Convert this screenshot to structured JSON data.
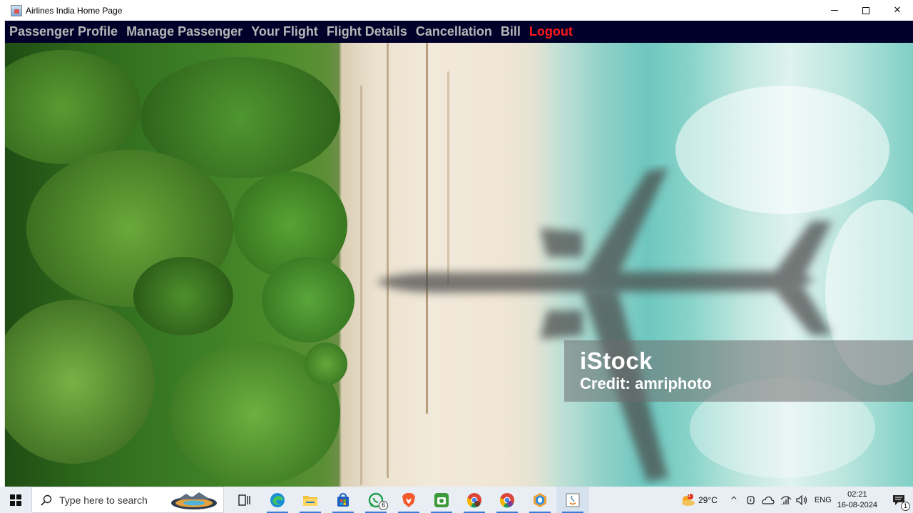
{
  "window": {
    "title": "Airlines India Home Page"
  },
  "menu": {
    "items": [
      {
        "label": "Passenger Profile"
      },
      {
        "label": "Manage Passenger"
      },
      {
        "label": "Your Flight"
      },
      {
        "label": "Flight Details"
      },
      {
        "label": "Cancellation"
      },
      {
        "label": "Bill"
      }
    ],
    "logout_label": "Logout",
    "colors": {
      "background": "#00002a",
      "item": "#b7b7b7",
      "logout": "#ff1a1a"
    }
  },
  "hero": {
    "watermark_brand": "iStock",
    "watermark_credit": "Credit: amriphoto"
  },
  "taskbar": {
    "search_placeholder": "Type here to search",
    "whatsapp_badge": "6",
    "weather_badge": "1",
    "temperature": "29°C",
    "language": "ENG",
    "time": "02:21",
    "date": "16-08-2024",
    "notification_badge": "1",
    "apps": [
      "task-view",
      "edge",
      "file-explorer",
      "store",
      "whatsapp",
      "brave",
      "android-app",
      "chrome",
      "chrome-profile",
      "cube-app",
      "java-app"
    ]
  }
}
